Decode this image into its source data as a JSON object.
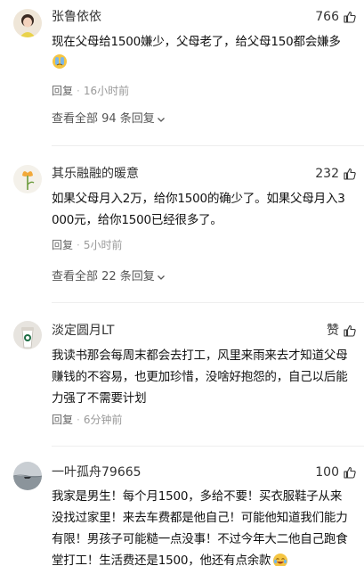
{
  "comments": [
    {
      "username": "张鲁依依",
      "likes": "766",
      "lines": [
        "现在父母给1500嫌少，父母老了，给父母150都会嫌多"
      ],
      "emoji_icon": "facepalm-emoji",
      "reply_label": "回复",
      "time": "16小时前",
      "view_replies": "查看全部 94 条回复"
    },
    {
      "username": "其乐融融的暖意",
      "likes": "232",
      "lines": [
        "如果父母月入2万，给你1500的确少了。如果父母月入3",
        "000元，给你1500已经很多了。"
      ],
      "reply_label": "回复",
      "time": "5小时前",
      "view_replies": "查看全部 22 条回复"
    },
    {
      "username": "淡定圆月LT",
      "likes": "赞",
      "lines": [
        "我读书那会每周末都会去打工，风里来雨来去才知道父母",
        "赚钱的不容易，也更加珍惜，没啥好抱怨的，自己以后能",
        "力强了不需要计划"
      ],
      "reply_label": "回复",
      "time": "6分钟前"
    },
    {
      "username": "一叶孤舟79665",
      "likes": "100",
      "lines": [
        "我家是男生！每个月1500，多给不要！买衣服鞋子从来",
        "没找过家里！来去车费都是他自己！可能他知道我们能力",
        "有限！男孩子可能糙一点没事！不过今年大二他自己跑食",
        "堂打工！生活费还是1500，他还有点余款"
      ],
      "emoji_icon": "laughing-tears-emoji"
    }
  ],
  "icons": {
    "like": "thumbs-up-icon",
    "expand": "chevron-down-icon"
  }
}
